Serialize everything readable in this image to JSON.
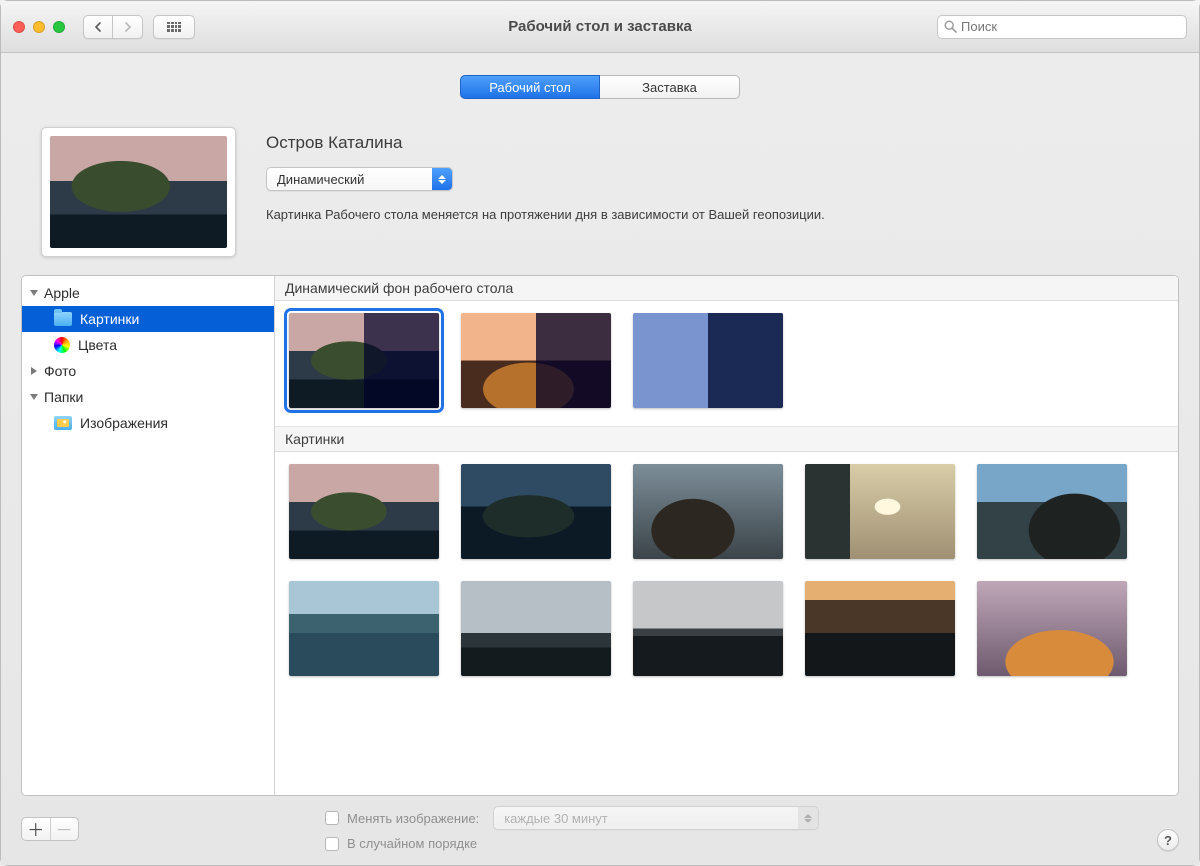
{
  "window": {
    "title": "Рабочий стол и заставка"
  },
  "search": {
    "placeholder": "Поиск"
  },
  "tabs": {
    "desktop": "Рабочий стол",
    "screensaver": "Заставка"
  },
  "preview": {
    "title": "Остров Каталина",
    "mode_selected": "Динамический",
    "description": "Картинка Рабочего стола меняется на протяжении дня в зависимости от Вашей геопозиции."
  },
  "sidebar": {
    "apple": "Apple",
    "pictures": "Картинки",
    "colors": "Цвета",
    "photos": "Фото",
    "folders": "Папки",
    "images": "Изображения"
  },
  "sections": {
    "dynamic": "Динамический фон рабочего стола",
    "pictures": "Картинки"
  },
  "bottom": {
    "change_label": "Менять изображение:",
    "interval_selected": "каждые 30 минут",
    "random_label": "В случайном порядке"
  },
  "icons": {
    "help": "?"
  }
}
